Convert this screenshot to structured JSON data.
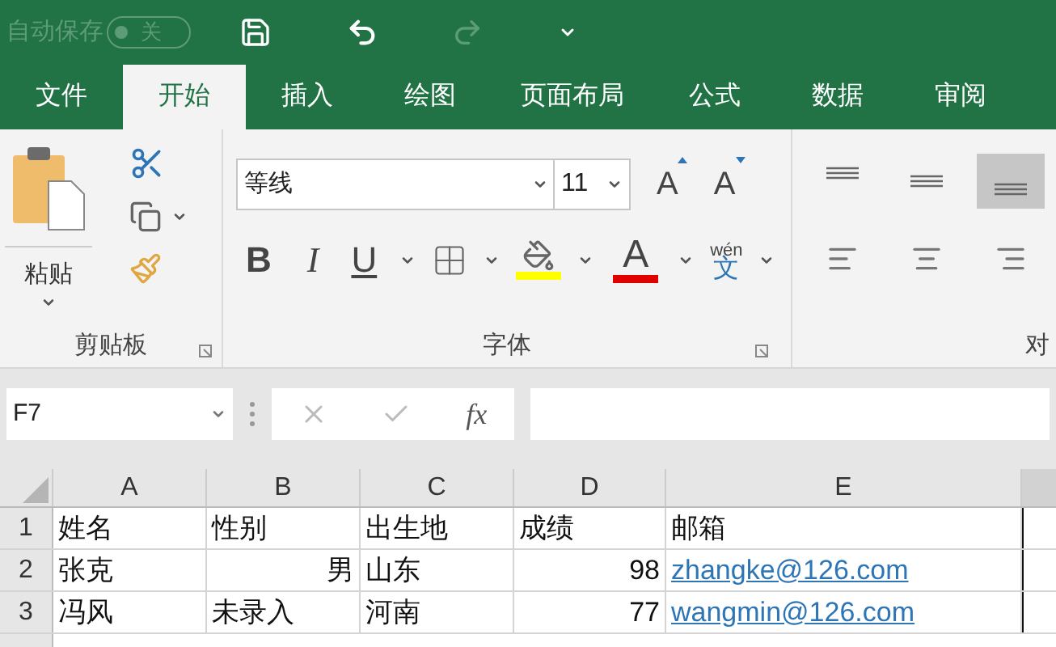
{
  "title_bar": {
    "autosave_label": "自动保存",
    "autosave_toggle": {
      "on": false,
      "label": "关"
    }
  },
  "tabs": [
    {
      "label": "文件",
      "selected": false
    },
    {
      "label": "开始",
      "selected": true
    },
    {
      "label": "插入",
      "selected": false
    },
    {
      "label": "绘图",
      "selected": false
    },
    {
      "label": "页面布局",
      "selected": false
    },
    {
      "label": "公式",
      "selected": false
    },
    {
      "label": "数据",
      "selected": false
    },
    {
      "label": "审阅",
      "selected": false
    }
  ],
  "clipboard": {
    "paste_label": "粘贴",
    "group_label": "剪贴板"
  },
  "font": {
    "font_name": "等线",
    "font_size": "11",
    "grow_label": "A",
    "shrink_label": "A",
    "bold_label": "B",
    "italic_label": "I",
    "underline_label": "U",
    "font_color_label": "A",
    "phonetic_top": "wén",
    "phonetic_char": "文",
    "group_label": "字体"
  },
  "alignment": {
    "vertical": [
      {
        "kind": "top",
        "selected": false
      },
      {
        "kind": "middle",
        "selected": false
      },
      {
        "kind": "bottom",
        "selected": true
      }
    ],
    "horizontal": [
      {
        "kind": "left",
        "selected": false
      },
      {
        "kind": "center",
        "selected": false
      },
      {
        "kind": "right",
        "selected": false
      }
    ],
    "group_label": "对"
  },
  "formula_bar": {
    "name_box": "F7",
    "fx_label": "fx"
  },
  "sheet": {
    "columns": [
      "A",
      "B",
      "C",
      "D",
      "E"
    ],
    "rows": [
      {
        "number": "1",
        "cells": [
          {
            "text": "姓名",
            "kind": "text"
          },
          {
            "text": "性别",
            "kind": "text"
          },
          {
            "text": "出生地",
            "kind": "text"
          },
          {
            "text": "成绩",
            "kind": "text"
          },
          {
            "text": "邮箱",
            "kind": "text"
          }
        ]
      },
      {
        "number": "2",
        "cells": [
          {
            "text": "张克",
            "kind": "text"
          },
          {
            "text": "男",
            "kind": "right"
          },
          {
            "text": "山东",
            "kind": "text"
          },
          {
            "text": "98",
            "kind": "right"
          },
          {
            "text": "zhangke@126.com",
            "kind": "link"
          }
        ]
      },
      {
        "number": "3",
        "cells": [
          {
            "text": "冯风",
            "kind": "text"
          },
          {
            "text": "未录入",
            "kind": "text"
          },
          {
            "text": "河南",
            "kind": "text"
          },
          {
            "text": "77",
            "kind": "right"
          },
          {
            "text": "wangmin@126.com",
            "kind": "link"
          }
        ]
      }
    ]
  }
}
